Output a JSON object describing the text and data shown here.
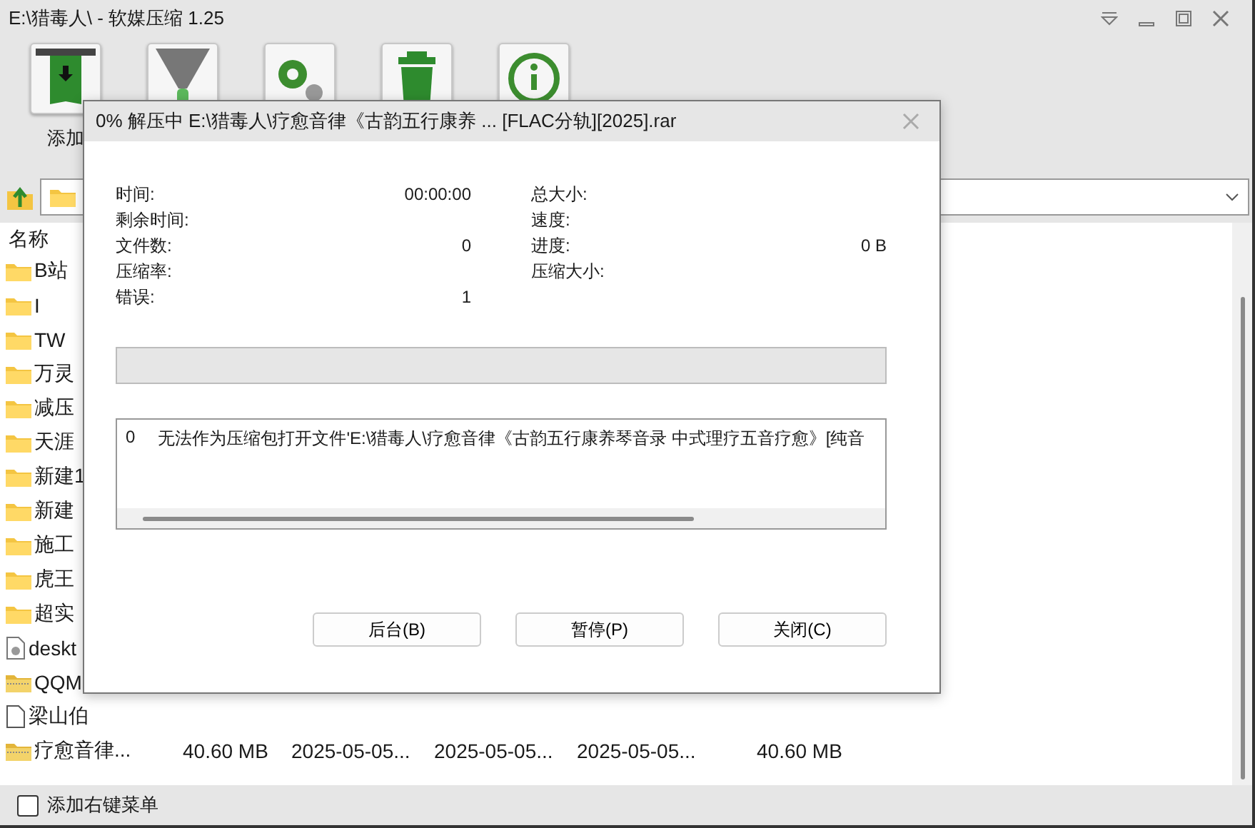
{
  "window": {
    "title": "E:\\猎毒人\\ - 软媒压缩 1.25"
  },
  "toolbar": {
    "buttons": [
      {
        "kind": "add",
        "label": "添加"
      },
      {
        "kind": "extract"
      },
      {
        "kind": "settings"
      },
      {
        "kind": "delete"
      },
      {
        "kind": "info"
      }
    ]
  },
  "file_list": {
    "columns": [
      "名称"
    ],
    "rows": [
      {
        "kind": "folder",
        "name": "B站"
      },
      {
        "kind": "folder",
        "name": "I"
      },
      {
        "kind": "folder",
        "name": "TW"
      },
      {
        "kind": "folder",
        "name": "万灵"
      },
      {
        "kind": "folder",
        "name": "减压"
      },
      {
        "kind": "folder",
        "name": "天涯"
      },
      {
        "kind": "folder",
        "name": "新建1"
      },
      {
        "kind": "folder",
        "name": "新建"
      },
      {
        "kind": "folder",
        "name": "施工"
      },
      {
        "kind": "folder",
        "name": "虎王"
      },
      {
        "kind": "folder",
        "name": "超实"
      },
      {
        "kind": "settings-file",
        "name": "deskt"
      },
      {
        "kind": "archive",
        "name": "QQM"
      },
      {
        "kind": "file",
        "name": "梁山伯"
      },
      {
        "kind": "archive",
        "name": "疗愈音律...",
        "cells": [
          "40.60 MB",
          "2025-05-05...",
          "2025-05-05...",
          "2025-05-05...",
          "40.60 MB"
        ]
      }
    ]
  },
  "context_menu_option": {
    "label": "添加右键菜单",
    "checked": false
  },
  "dialog": {
    "title": "0% 解压中 E:\\猎毒人\\疗愈音律《古韵五行康养 ... [FLAC分轨][2025].rar",
    "left_stats": [
      {
        "label": "时间:",
        "value": "00:00:00"
      },
      {
        "label": "剩余时间:"
      },
      {
        "label": "文件数:",
        "value": "0"
      },
      {
        "label": "压缩率:"
      },
      {
        "label": "错误:",
        "value": "1"
      }
    ],
    "right_stats": [
      {
        "label": "总大小:"
      },
      {
        "label": "速度:"
      },
      {
        "label": "进度:",
        "value": "0 B"
      },
      {
        "label": "压缩大小:"
      }
    ],
    "progress": {
      "level": 0
    },
    "log": [
      {
        "index": "0",
        "message": "无法作为压缩包打开文件'E:\\猎毒人\\疗愈音律《古韵五行康养琴音录 中式理疗五音疗愈》[纯音"
      }
    ],
    "buttons": [
      "后台(B)",
      "暂停(P)",
      "关闭(C)"
    ]
  }
}
